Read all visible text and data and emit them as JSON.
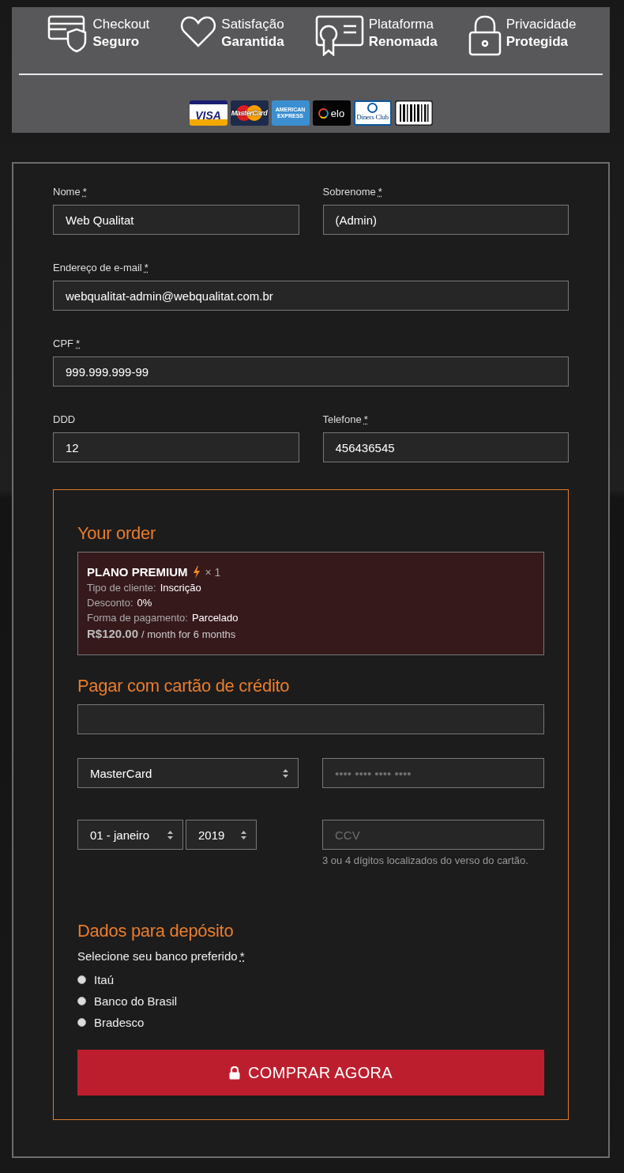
{
  "trust_badges": [
    {
      "kind": "card-shield",
      "line1": "Checkout",
      "line2": "Seguro"
    },
    {
      "kind": "heart",
      "line1": "Satisfação",
      "line2": "Garantida"
    },
    {
      "kind": "certificate",
      "line1": "Plataforma",
      "line2": "Renomada"
    },
    {
      "kind": "lock",
      "line1": "Privacidade",
      "line2": "Protegida"
    }
  ],
  "payment_logos": [
    {
      "kind": "visa",
      "text": "VISA"
    },
    {
      "kind": "mastercard",
      "text": "MasterCard"
    },
    {
      "kind": "amex",
      "text": "AMERICAN EXPRESS"
    },
    {
      "kind": "elo",
      "text": "elo"
    },
    {
      "kind": "diners",
      "text": "Diners Club"
    },
    {
      "kind": "barcode"
    }
  ],
  "customer_fields": [
    [
      {
        "label": "Nome",
        "required_mark": "*",
        "value": "Web Qualitat"
      },
      {
        "label": "Sobrenome",
        "required_mark": "*",
        "value": "(Admin)"
      }
    ],
    [
      {
        "label": "Endereço de e-mail",
        "required_mark": "*",
        "value": "webqualitat-admin@webqualitat.com.br"
      }
    ],
    [
      {
        "label": "CPF",
        "required_mark": "*",
        "value": "999.999.999-99"
      }
    ],
    [
      {
        "label": "DDD",
        "value": "12"
      },
      {
        "label": "Telefone",
        "required_mark": "*",
        "value": "456436545"
      }
    ]
  ],
  "order": {
    "title": "Your order",
    "item": {
      "name": "PLANO PREMIUM",
      "quantity": "× 1",
      "meta": [
        {
          "label": "Tipo de cliente:",
          "value": "Inscrição"
        },
        {
          "label": "Desconto:",
          "value": "0%"
        },
        {
          "label": "Forma de pagamento:",
          "value": "Parcelado"
        }
      ],
      "price": "R$120.00",
      "price_suffix": "/ month for 6 months"
    }
  },
  "card_payment": {
    "title": "Pagar com cartão de crédito",
    "brand": "MasterCard",
    "number_placeholder": "•••• •••• •••• ••••",
    "month": "01 - janeiro",
    "year": "2019",
    "ccv_placeholder": "CCV",
    "ccv_hint": "3 ou 4 dígitos localizados do verso do cartão."
  },
  "deposit": {
    "title": "Dados para depósito",
    "prompt": "Selecione seu banco preferido",
    "required_mark": "*",
    "banks": [
      {
        "label": "Itaú",
        "selected": false
      },
      {
        "label": "Banco do Brasil",
        "selected": false
      },
      {
        "label": "Bradesco",
        "selected": false
      }
    ]
  },
  "submit_button": "COMPRAR AGORA"
}
